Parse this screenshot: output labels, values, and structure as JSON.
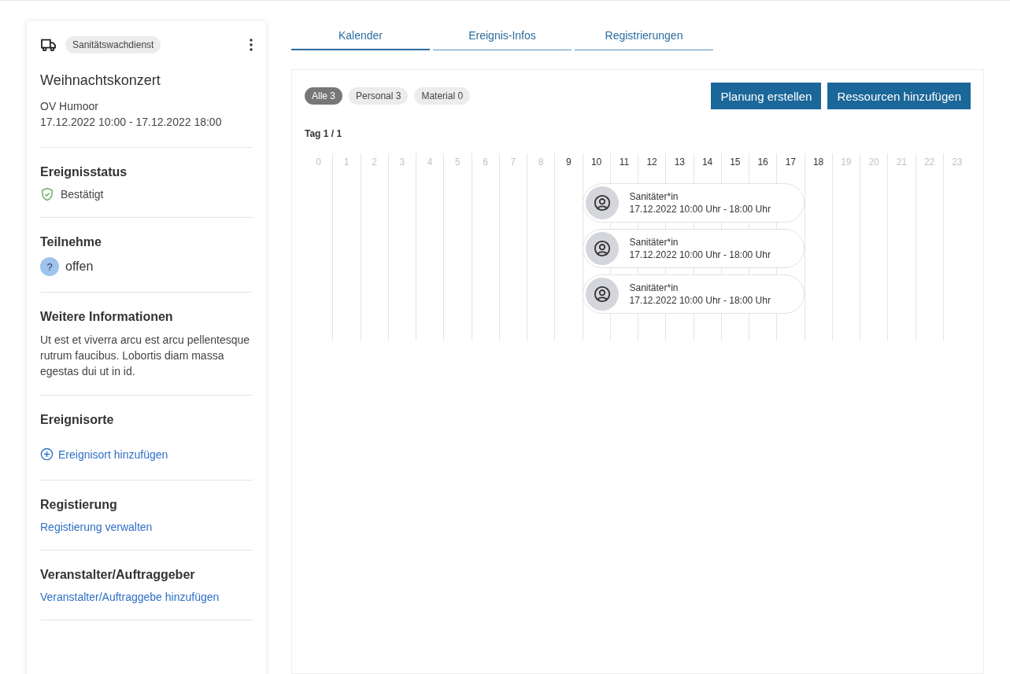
{
  "card": {
    "tag": "Sanitätswachdienst",
    "title": "Weihnachtskonzert",
    "org": "OV Humoor",
    "dates": "17.12.2022 10:00 - 17.12.2022 18:00",
    "sections": [
      {
        "kind": "status",
        "heading": "Ereignisstatus",
        "text": "Bestätigt"
      },
      {
        "kind": "participation",
        "heading": "Teilnehme",
        "symbol": "?",
        "text": "offen"
      },
      {
        "kind": "text",
        "heading": "Weitere Informationen",
        "text": "Ut est et viverra arcu est arcu pellentesque rutrum faucibus. Lobortis diam massa egestas dui ut in id."
      },
      {
        "kind": "add",
        "heading": "Ereignisorte",
        "text": "Ereignisort hinzufügen"
      },
      {
        "kind": "link",
        "heading": "Registierung",
        "text": "Registierung verwalten"
      },
      {
        "kind": "link",
        "heading": "Veranstalter/Auftraggeber",
        "text": "Veranstalter/Auftraggebe hinzufügen"
      }
    ]
  },
  "tabs": [
    {
      "label": "Kalender",
      "selected": true
    },
    {
      "label": "Ereignis-Infos",
      "selected": false
    },
    {
      "label": "Registrierungen",
      "selected": false
    }
  ],
  "filters": [
    {
      "label": "Alle 3",
      "selected": true
    },
    {
      "label": "Personal 3",
      "selected": false
    },
    {
      "label": "Material 0",
      "selected": false
    }
  ],
  "buttons": [
    "Planung erstellen",
    "Ressourcen hinzufügen"
  ],
  "day_label": "Tag 1 / 1",
  "hours": [
    {
      "label": "0",
      "active": false
    },
    {
      "label": "1",
      "active": false
    },
    {
      "label": "2",
      "active": false
    },
    {
      "label": "3",
      "active": false
    },
    {
      "label": "4",
      "active": false
    },
    {
      "label": "5",
      "active": false
    },
    {
      "label": "6",
      "active": false
    },
    {
      "label": "7",
      "active": false
    },
    {
      "label": "8",
      "active": false
    },
    {
      "label": "9",
      "active": true
    },
    {
      "label": "10",
      "active": true
    },
    {
      "label": "11",
      "active": true
    },
    {
      "label": "12",
      "active": true
    },
    {
      "label": "13",
      "active": true
    },
    {
      "label": "14",
      "active": true
    },
    {
      "label": "15",
      "active": true
    },
    {
      "label": "16",
      "active": true
    },
    {
      "label": "17",
      "active": true
    },
    {
      "label": "18",
      "active": true
    },
    {
      "label": "19",
      "active": false
    },
    {
      "label": "20",
      "active": false
    },
    {
      "label": "21",
      "active": false
    },
    {
      "label": "22",
      "active": false
    },
    {
      "label": "23",
      "active": false
    }
  ],
  "bookings": [
    {
      "title": "Sanitäter*in",
      "time": "17.12.2022 10:00 Uhr - 18:00 Uhr"
    },
    {
      "title": "Sanitäter*in",
      "time": "17.12.2022 10:00 Uhr - 18:00 Uhr"
    },
    {
      "title": "Sanitäter*in",
      "time": "17.12.2022 10:00 Uhr - 18:00 Uhr"
    }
  ]
}
